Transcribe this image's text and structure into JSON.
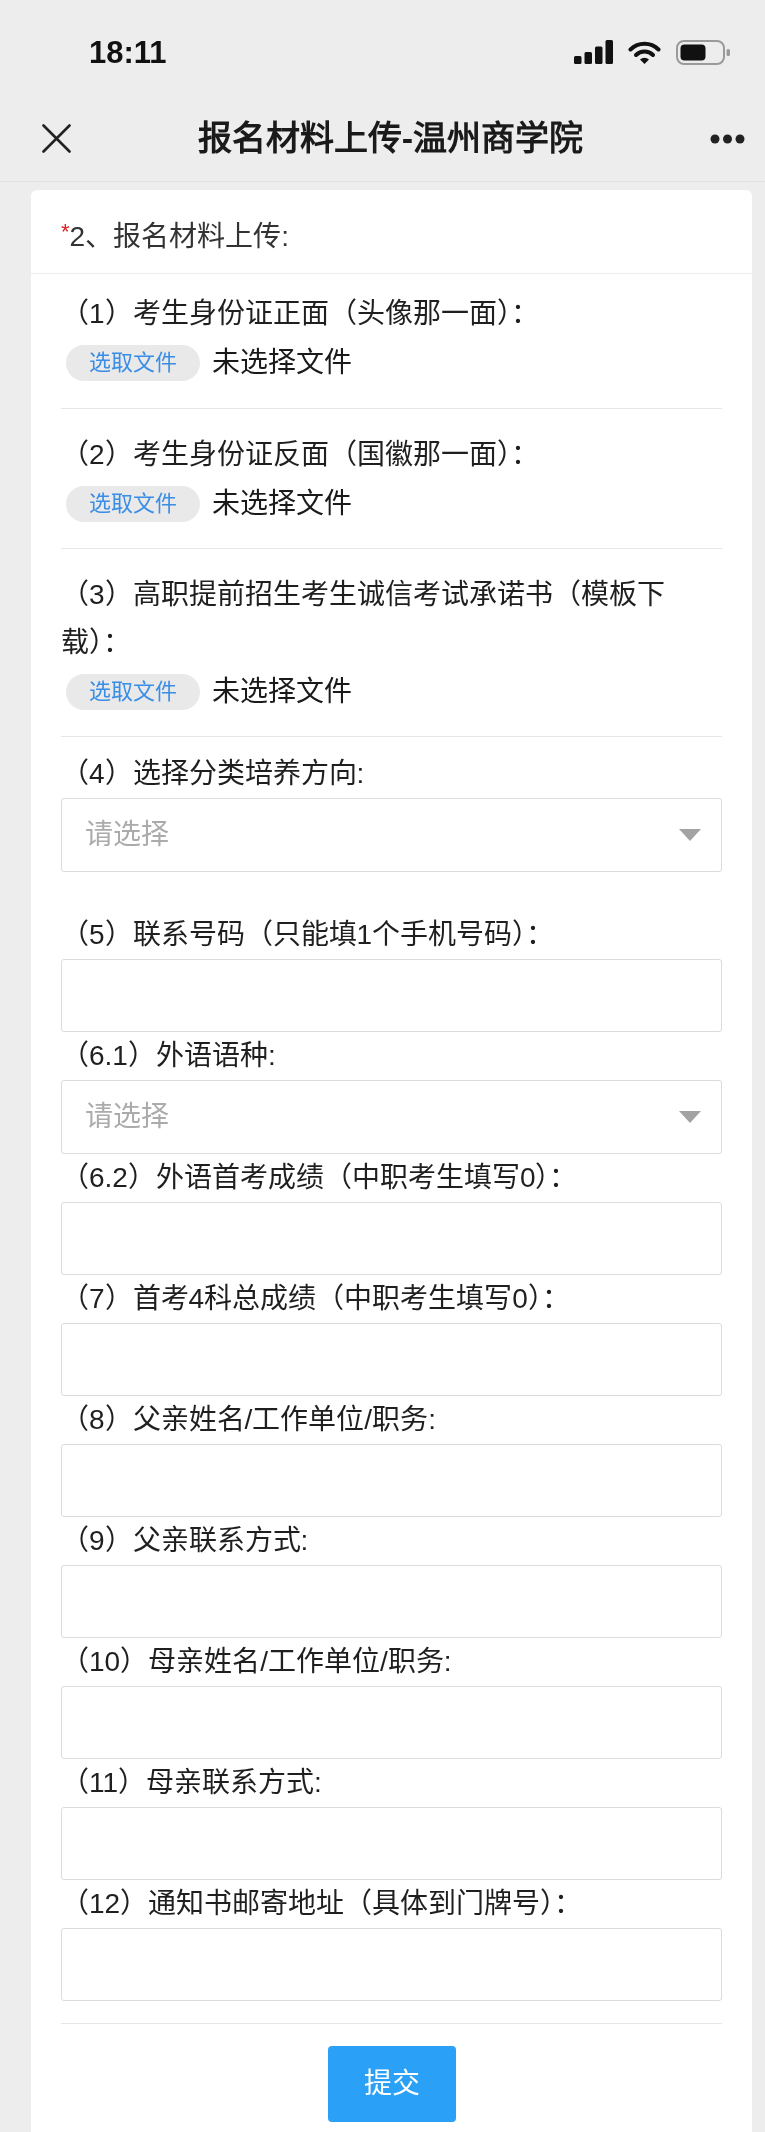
{
  "status_bar": {
    "time": "18:11"
  },
  "nav_bar": {
    "title": "报名材料上传-温州商学院"
  },
  "section": {
    "required_mark": "*",
    "title": "2、报名材料上传:"
  },
  "fields": [
    {
      "kind": "file",
      "label": "（1）考生身份证正面（头像那一面）：",
      "button": "选取文件",
      "status": "未选择文件"
    },
    {
      "kind": "file",
      "label": "（2）考生身份证反面（国徽那一面）：",
      "button": "选取文件",
      "status": "未选择文件"
    },
    {
      "kind": "file",
      "label": "（3）高职提前招生考生诚信考试承诺书（模板下载）：",
      "button": "选取文件",
      "status": "未选择文件"
    },
    {
      "kind": "select",
      "label": "（4）选择分类培养方向:",
      "placeholder": "请选择"
    },
    {
      "kind": "text",
      "label": "（5）联系号码（只能填1个手机号码）："
    },
    {
      "kind": "select",
      "label": "（6.1）外语语种:",
      "placeholder": "请选择"
    },
    {
      "kind": "text",
      "label": "（6.2）外语首考成绩（中职考生填写0）："
    },
    {
      "kind": "text",
      "label": "（7）首考4科总成绩（中职考生填写0）："
    },
    {
      "kind": "text",
      "label": "（8）父亲姓名/工作单位/职务:"
    },
    {
      "kind": "text",
      "label": "（9）父亲联系方式:"
    },
    {
      "kind": "text",
      "label": "（10）母亲姓名/工作单位/职务:"
    },
    {
      "kind": "text",
      "label": "（11）母亲联系方式:"
    },
    {
      "kind": "text",
      "label": "（12）通知书邮寄地址（具体到门牌号）："
    }
  ],
  "submit": {
    "label": "提交"
  }
}
